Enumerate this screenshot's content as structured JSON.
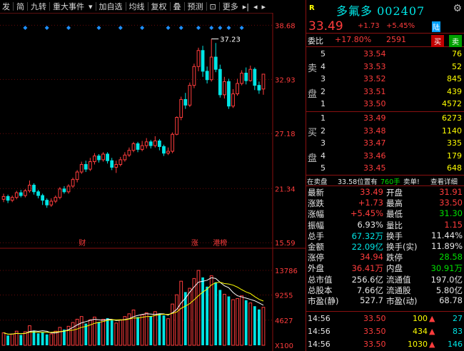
{
  "toolbar": {
    "items": [
      "发",
      "简",
      "九转",
      "重大事件",
      "加自选",
      "均线",
      "复权",
      "叠",
      "预测",
      "更多"
    ]
  },
  "stock": {
    "badge": "R",
    "name": "多氟多",
    "code": "002407",
    "price": "33.49",
    "change": "+1.73",
    "pct": "+5.45%",
    "market": "陆"
  },
  "weibi": {
    "label": "委比",
    "ratio": "+17.80%",
    "diff": "2591",
    "buy": "买",
    "sell": "卖"
  },
  "sell_side": "卖盘",
  "buy_side": "买盘",
  "asks": [
    {
      "level": "5",
      "price": "33.54",
      "vol": "76"
    },
    {
      "level": "4",
      "price": "33.53",
      "vol": "52"
    },
    {
      "level": "3",
      "price": "33.52",
      "vol": "845"
    },
    {
      "level": "2",
      "price": "33.51",
      "vol": "439"
    },
    {
      "level": "1",
      "price": "33.50",
      "vol": "4572"
    }
  ],
  "bids": [
    {
      "level": "1",
      "price": "33.49",
      "vol": "6273"
    },
    {
      "level": "2",
      "price": "33.48",
      "vol": "1140"
    },
    {
      "level": "3",
      "price": "33.47",
      "vos": "",
      "vol": "335"
    },
    {
      "level": "4",
      "price": "33.46",
      "vol": "179"
    },
    {
      "level": "5",
      "price": "33.45",
      "vol": "648"
    }
  ],
  "deal": {
    "a": "在卖盘",
    "b": "33.58位置有",
    "c": "760手",
    "d": "卖单!",
    "e": "查看详细"
  },
  "stats": [
    {
      "l1": "最新",
      "v1": "33.49",
      "c1": "red",
      "l2": "开盘",
      "v2": "31.91",
      "c2": "red"
    },
    {
      "l1": "涨跌",
      "v1": "+1.73",
      "c1": "red",
      "l2": "最高",
      "v2": "33.50",
      "c2": "red"
    },
    {
      "l1": "涨幅",
      "v1": "+5.45%",
      "c1": "red",
      "l2": "最低",
      "v2": "31.30",
      "c2": "green"
    },
    {
      "l1": "振幅",
      "v1": "6.93%",
      "c1": "white",
      "l2": "量比",
      "v2": "1.15",
      "c2": "red"
    },
    {
      "l1": "总手",
      "v1": "67.32万",
      "c1": "cyan",
      "l2": "换手",
      "v2": "11.44%",
      "c2": "white"
    },
    {
      "l1": "金额",
      "v1": "22.09亿",
      "c1": "cyan",
      "l2": "换手(实)",
      "v2": "11.89%",
      "c2": "white"
    },
    {
      "l1": "涨停",
      "v1": "34.94",
      "c1": "red",
      "l2": "跌停",
      "v2": "28.58",
      "c2": "green"
    },
    {
      "l1": "外盘",
      "v1": "36.41万",
      "c1": "red",
      "l2": "内盘",
      "v2": "30.91万",
      "c2": "green"
    },
    {
      "l1": "总市值",
      "v1": "256.6亿",
      "c1": "white",
      "l2": "流通值",
      "v2": "197.0亿",
      "c2": "white"
    },
    {
      "l1": "总股本",
      "v1": "7.66亿",
      "c1": "white",
      "l2": "流通股",
      "v2": "5.80亿",
      "c2": "white"
    },
    {
      "l1": "市盈(静)",
      "v1": "527.7",
      "c1": "white",
      "l2": "市盈(动)",
      "v2": "68.78",
      "c2": "white"
    }
  ],
  "ticks": [
    {
      "time": "14:56",
      "price": "33.50",
      "vol": "100",
      "n": "27"
    },
    {
      "time": "14:56",
      "price": "33.50",
      "vol": "434",
      "n": "83"
    },
    {
      "time": "14:56",
      "price": "33.50",
      "vol": "1030",
      "n": "146"
    }
  ],
  "chart_data": {
    "type": "candlestick",
    "price_axis": {
      "labels": [
        "38.68",
        "32.93",
        "27.18",
        "21.34",
        "15.59"
      ]
    },
    "volume_axis": {
      "labels": [
        "13786",
        "9255",
        "4627"
      ],
      "unit": "X100"
    },
    "max_label": "37.23",
    "event_labels": [
      "财",
      "涨",
      "港榜"
    ],
    "colors": {
      "up": "#ff3c3c",
      "down": "#00e5e5",
      "ma5": "#ffffff",
      "ma10": "#ffff00",
      "grid": "#6a0a0a"
    },
    "candles": [
      {
        "o": 20.2,
        "c": 20.5,
        "h": 20.8,
        "l": 19.9
      },
      {
        "o": 20.5,
        "c": 20.1,
        "h": 20.7,
        "l": 19.8
      },
      {
        "o": 20.1,
        "c": 20.4,
        "h": 20.6,
        "l": 19.9
      },
      {
        "o": 20.4,
        "c": 20.9,
        "h": 21.1,
        "l": 20.2
      },
      {
        "o": 20.9,
        "c": 20.6,
        "h": 21.2,
        "l": 20.4
      },
      {
        "o": 20.6,
        "c": 21.1,
        "h": 21.3,
        "l": 20.4
      },
      {
        "o": 21.1,
        "c": 21.7,
        "h": 22.2,
        "l": 20.9
      },
      {
        "o": 21.7,
        "c": 21.0,
        "h": 21.9,
        "l": 20.7
      },
      {
        "o": 21.0,
        "c": 20.6,
        "h": 21.2,
        "l": 20.3
      },
      {
        "o": 20.6,
        "c": 20.1,
        "h": 20.8,
        "l": 19.6
      },
      {
        "o": 20.1,
        "c": 19.6,
        "h": 20.3,
        "l": 19.3
      },
      {
        "o": 19.6,
        "c": 20.0,
        "h": 20.3,
        "l": 19.4
      },
      {
        "o": 20.0,
        "c": 20.4,
        "h": 20.6,
        "l": 19.8
      },
      {
        "o": 20.4,
        "c": 21.3,
        "h": 21.5,
        "l": 20.2
      },
      {
        "o": 21.3,
        "c": 21.0,
        "h": 21.6,
        "l": 20.8
      },
      {
        "o": 21.0,
        "c": 21.6,
        "h": 21.8,
        "l": 20.8
      },
      {
        "o": 21.6,
        "c": 22.3,
        "h": 22.5,
        "l": 21.4
      },
      {
        "o": 22.3,
        "c": 23.1,
        "h": 23.3,
        "l": 22.0
      },
      {
        "o": 23.1,
        "c": 23.9,
        "h": 24.2,
        "l": 22.9
      },
      {
        "o": 23.9,
        "c": 23.4,
        "h": 24.3,
        "l": 23.1
      },
      {
        "o": 23.4,
        "c": 24.2,
        "h": 24.6,
        "l": 23.2
      },
      {
        "o": 24.2,
        "c": 24.8,
        "h": 25.1,
        "l": 23.9
      },
      {
        "o": 24.8,
        "c": 24.4,
        "h": 25.0,
        "l": 24.1
      },
      {
        "o": 24.4,
        "c": 25.0,
        "h": 25.2,
        "l": 24.2
      },
      {
        "o": 25.0,
        "c": 24.3,
        "h": 25.2,
        "l": 24.0
      },
      {
        "o": 24.3,
        "c": 23.6,
        "h": 24.6,
        "l": 23.3
      },
      {
        "o": 23.6,
        "c": 23.9,
        "h": 24.3,
        "l": 23.0
      },
      {
        "o": 23.9,
        "c": 24.4,
        "h": 24.7,
        "l": 23.7
      },
      {
        "o": 24.4,
        "c": 24.9,
        "h": 25.2,
        "l": 24.2
      },
      {
        "o": 24.9,
        "c": 25.4,
        "h": 25.7,
        "l": 24.7
      },
      {
        "o": 25.4,
        "c": 26.1,
        "h": 26.3,
        "l": 25.2
      },
      {
        "o": 26.1,
        "c": 25.5,
        "h": 26.3,
        "l": 25.2
      },
      {
        "o": 25.5,
        "c": 25.9,
        "h": 26.4,
        "l": 25.3
      },
      {
        "o": 25.9,
        "c": 26.3,
        "h": 26.7,
        "l": 25.6
      },
      {
        "o": 26.3,
        "c": 25.9,
        "h": 26.5,
        "l": 25.6
      },
      {
        "o": 25.9,
        "c": 26.4,
        "h": 26.9,
        "l": 25.7
      },
      {
        "o": 26.4,
        "c": 25.8,
        "h": 26.6,
        "l": 25.4
      },
      {
        "o": 25.8,
        "c": 25.1,
        "h": 26.0,
        "l": 24.8
      },
      {
        "o": 25.1,
        "c": 25.3,
        "h": 25.7,
        "l": 24.9
      },
      {
        "o": 25.3,
        "c": 27.1,
        "h": 27.3,
        "l": 25.1
      },
      {
        "o": 27.1,
        "c": 28.9,
        "h": 29.0,
        "l": 27.0
      },
      {
        "o": 28.9,
        "c": 30.8,
        "h": 31.1,
        "l": 28.6
      },
      {
        "o": 30.8,
        "c": 30.2,
        "h": 31.5,
        "l": 29.8
      },
      {
        "o": 30.2,
        "c": 32.3,
        "h": 32.6,
        "l": 30.0
      },
      {
        "o": 32.3,
        "c": 34.3,
        "h": 34.6,
        "l": 32.0
      },
      {
        "o": 34.3,
        "c": 36.0,
        "h": 36.3,
        "l": 33.8
      },
      {
        "o": 36.0,
        "c": 33.8,
        "h": 36.5,
        "l": 33.2
      },
      {
        "o": 33.8,
        "c": 32.9,
        "h": 34.3,
        "l": 32.5
      },
      {
        "o": 32.9,
        "c": 35.3,
        "h": 37.23,
        "l": 32.7
      },
      {
        "o": 35.3,
        "c": 34.0,
        "h": 36.8,
        "l": 33.7
      },
      {
        "o": 34.0,
        "c": 31.3,
        "h": 34.5,
        "l": 31.0
      },
      {
        "o": 31.3,
        "c": 32.7,
        "h": 33.2,
        "l": 30.9
      },
      {
        "o": 32.7,
        "c": 30.1,
        "h": 33.0,
        "l": 29.8
      },
      {
        "o": 30.1,
        "c": 31.4,
        "h": 31.9,
        "l": 29.9
      },
      {
        "o": 31.4,
        "c": 32.5,
        "h": 33.0,
        "l": 31.2
      },
      {
        "o": 32.5,
        "c": 33.6,
        "h": 33.9,
        "l": 32.3
      },
      {
        "o": 33.6,
        "c": 32.8,
        "h": 34.2,
        "l": 32.4
      },
      {
        "o": 32.8,
        "c": 34.0,
        "h": 34.4,
        "l": 32.7
      },
      {
        "o": 34.0,
        "c": 32.3,
        "h": 34.2,
        "l": 31.8
      },
      {
        "o": 32.3,
        "c": 31.8,
        "h": 32.7,
        "l": 31.4
      },
      {
        "o": 31.91,
        "c": 33.49,
        "h": 33.5,
        "l": 31.3
      }
    ],
    "volumes": [
      2300,
      1800,
      2100,
      2600,
      1900,
      2500,
      3600,
      2700,
      2200,
      2400,
      2000,
      2100,
      2600,
      3300,
      2900,
      3500,
      4200,
      4800,
      5300,
      4000,
      4700,
      5200,
      4300,
      4800,
      5000,
      4600,
      4100,
      4700,
      5300,
      5800,
      6500,
      5200,
      5600,
      6000,
      5400,
      6200,
      5800,
      5500,
      4900,
      7600,
      9300,
      11800,
      9800,
      10500,
      12300,
      13786,
      12500,
      10800,
      12800,
      11600,
      10200,
      9400,
      9000,
      8400,
      8600,
      9100,
      8300,
      7800,
      7200,
      6600,
      7000
    ]
  }
}
